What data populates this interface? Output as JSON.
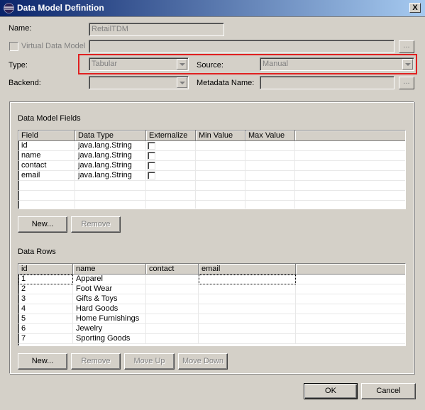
{
  "window": {
    "title": "Data Model Definition",
    "close_label": "X"
  },
  "form": {
    "name_label": "Name:",
    "name_value": "RetailTDM",
    "virtual_label": "Virtual Data Model",
    "virtual_dots": "...",
    "type_label": "Type:",
    "type_value": "Tabular",
    "source_label": "Source:",
    "source_value": "Manual",
    "backend_label": "Backend:",
    "backend_value": "",
    "metadata_label": "Metadata Name:",
    "metadata_value": "",
    "metadata_dots": "..."
  },
  "fields_section": {
    "title": "Data Model Fields",
    "columns": [
      "Field",
      "Data Type",
      "Externalize",
      "Min Value",
      "Max Value"
    ],
    "rows": [
      {
        "field": "id",
        "type": "java.lang.String",
        "externalize": false
      },
      {
        "field": "name",
        "type": "java.lang.String",
        "externalize": false
      },
      {
        "field": "contact",
        "type": "java.lang.String",
        "externalize": false
      },
      {
        "field": "email",
        "type": "java.lang.String",
        "externalize": false
      }
    ],
    "new_button": "New...",
    "remove_button": "Remove"
  },
  "rows_section": {
    "title": "Data Rows",
    "columns": [
      "id",
      "name",
      "contact",
      "email"
    ],
    "rows": [
      [
        "1",
        "Apparel",
        "",
        ""
      ],
      [
        "2",
        "Foot Wear",
        "",
        ""
      ],
      [
        "3",
        "Gifts & Toys",
        "",
        ""
      ],
      [
        "4",
        "Hard Goods",
        "",
        ""
      ],
      [
        "5",
        "Home Furnishings",
        "",
        ""
      ],
      [
        "6",
        "Jewelry",
        "",
        ""
      ],
      [
        "7",
        "Sporting Goods",
        "",
        ""
      ]
    ],
    "new_button": "New...",
    "remove_button": "Remove",
    "move_up_button": "Move Up",
    "move_down_button": "Move Down"
  },
  "footer": {
    "ok_button": "OK",
    "cancel_button": "Cancel"
  },
  "colors": {
    "titlebar_start": "#0a246a",
    "titlebar_end": "#a6caf0",
    "highlight": "#e02020",
    "dialog_bg": "#d4d0c8"
  }
}
